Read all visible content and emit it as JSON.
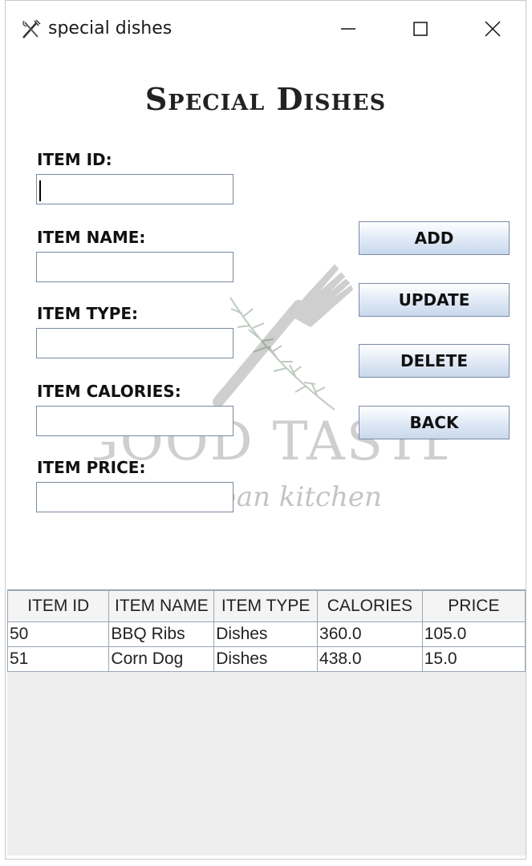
{
  "window": {
    "title": "special dishes",
    "icon": "fork-knife-icon"
  },
  "form": {
    "heading": "Special Dishes",
    "fields": [
      {
        "label": "ITEM ID:",
        "value": "",
        "placeholder": ""
      },
      {
        "label": "ITEM NAME:",
        "value": "",
        "placeholder": ""
      },
      {
        "label": "ITEM TYPE:",
        "value": "",
        "placeholder": ""
      },
      {
        "label": "ITEM CALORIES:",
        "value": "",
        "placeholder": ""
      },
      {
        "label": "ITEM PRICE:",
        "value": "",
        "placeholder": ""
      }
    ]
  },
  "buttons": {
    "add": "ADD",
    "update": "UPDATE",
    "delete": "DELETE",
    "back": "BACK"
  },
  "watermark": {
    "brand": "GOOD TASTE",
    "tagline": "Urban kitchen"
  },
  "table": {
    "columns": [
      "ITEM ID",
      "ITEM NAME",
      "ITEM TYPE",
      "CALORIES",
      "PRICE"
    ],
    "rows": [
      [
        "50",
        "BBQ Ribs",
        "Dishes",
        "360.0",
        "105.0"
      ],
      [
        "51",
        "Corn Dog",
        "Dishes",
        "438.0",
        "15.0"
      ]
    ]
  },
  "colors": {
    "button_gradient_top": "#ffffff",
    "button_gradient_bottom": "#c9d8ec",
    "table_empty_area": "#eeeeee",
    "border": "#9aa6b4"
  }
}
